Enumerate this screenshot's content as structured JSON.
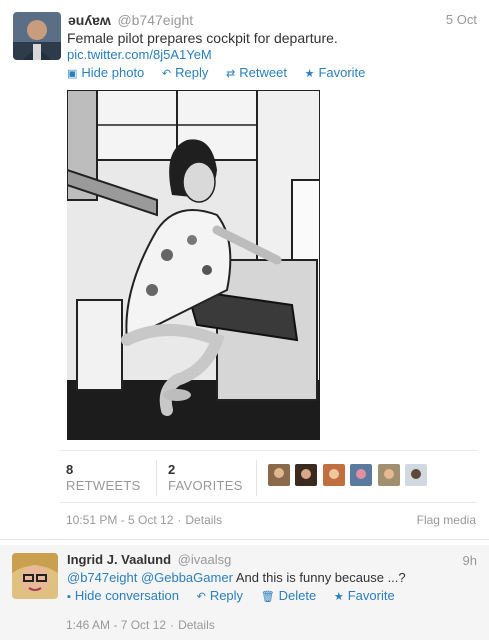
{
  "tweet": {
    "author_name": "ǝuʎɐʍ",
    "author_handle": "@b747eight",
    "timestamp": "5 Oct",
    "text": "Female pilot prepares cockpit for departure.",
    "link": "pic.twitter.com/8j5A1YeM",
    "actions": {
      "hide_photo": "Hide photo",
      "reply": "Reply",
      "retweet": "Retweet",
      "favorite": "Favorite"
    },
    "stats": {
      "retweets_count": "8",
      "retweets_label": "RETWEETS",
      "favorites_count": "2",
      "favorites_label": "FAVORITES"
    },
    "footer": {
      "datetime": "10:51 PM - 5 Oct 12",
      "details": "Details",
      "flag_media": "Flag media"
    }
  },
  "reply": {
    "author_name": "Ingrid J. Vaalund",
    "author_handle": "@ivaalsg",
    "timestamp": "9h",
    "mention1": "@b747eight",
    "mention2": "@GebbaGamer",
    "text": "And this is funny because ...?",
    "actions": {
      "hide_conversation": "Hide conversation",
      "reply": "Reply",
      "delete": "Delete",
      "favorite": "Favorite"
    },
    "footer": {
      "datetime": "1:46 AM - 7 Oct 12",
      "details": "Details"
    }
  },
  "colors": {
    "link": "#2a7fbd",
    "muted": "#999999",
    "text": "#333333",
    "reply_bg": "#f5f5f5"
  },
  "icons": [
    "photo-icon",
    "reply-icon",
    "retweet-icon",
    "star-icon",
    "trash-icon",
    "conversation-icon"
  ]
}
